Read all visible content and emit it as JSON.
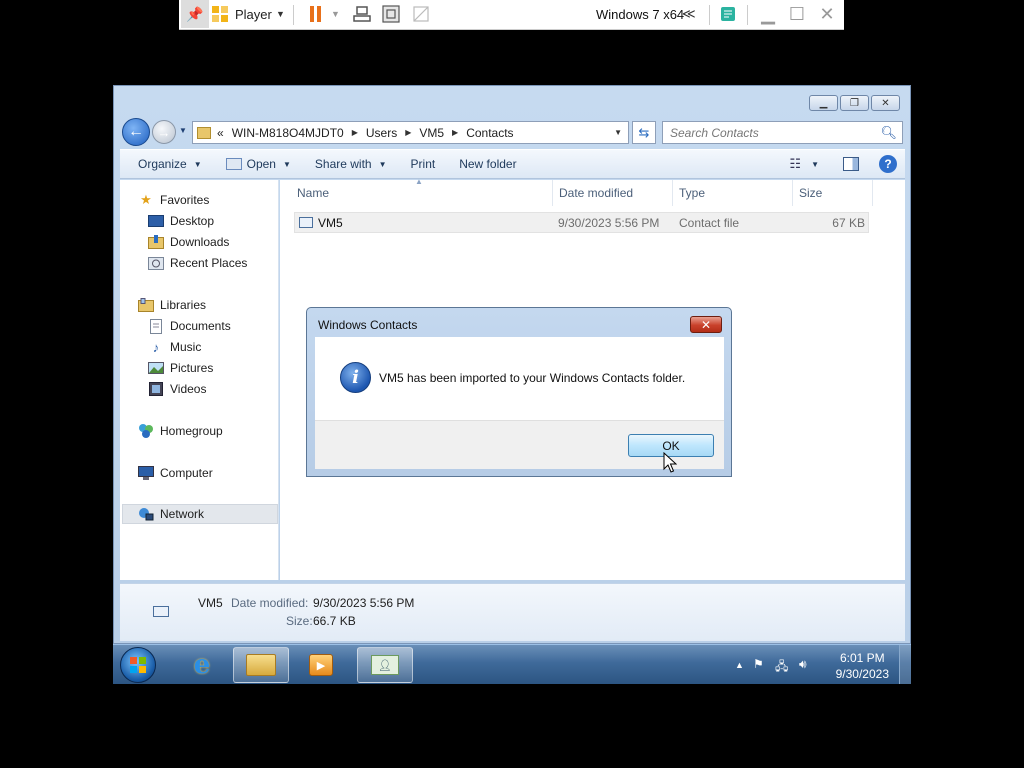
{
  "player": {
    "menu_label": "Player",
    "vm_name": "Windows 7 x64",
    "icons": [
      "pin-icon",
      "player-logo-icon",
      "pause-icon",
      "send-keys-icon",
      "fullscreen-icon",
      "unity-icon",
      "collapse-icon",
      "notes-icon",
      "minimize-icon",
      "maximize-icon",
      "close-icon"
    ]
  },
  "explorer": {
    "breadcrumb": [
      "WIN-M818O4MJDT0",
      "Users",
      "VM5",
      "Contacts"
    ],
    "breadcrumb_prefix": "«",
    "search_placeholder": "Search Contacts",
    "toolbar": {
      "organize": "Organize",
      "open": "Open",
      "share_with": "Share with",
      "print": "Print",
      "new_folder": "New folder"
    },
    "nav": {
      "favorites": "Favorites",
      "desktop": "Desktop",
      "downloads": "Downloads",
      "recent_places": "Recent Places",
      "libraries": "Libraries",
      "documents": "Documents",
      "music": "Music",
      "pictures": "Pictures",
      "videos": "Videos",
      "homegroup": "Homegroup",
      "computer": "Computer",
      "network": "Network"
    },
    "columns": {
      "name": "Name",
      "date_modified": "Date modified",
      "type": "Type",
      "size": "Size"
    },
    "files": [
      {
        "name": "VM5",
        "date_modified": "9/30/2023 5:56 PM",
        "type": "Contact file",
        "size": "67 KB"
      }
    ],
    "details": {
      "name": "VM5",
      "date_label": "Date modified:",
      "date_value": "9/30/2023 5:56 PM",
      "size_label": "Size:",
      "size_value": "66.7 KB"
    }
  },
  "dialog": {
    "title": "Windows Contacts",
    "message": "VM5 has been imported to your Windows Contacts folder.",
    "ok_label": "OK"
  },
  "taskbar": {
    "time": "6:01 PM",
    "date": "9/30/2023"
  }
}
